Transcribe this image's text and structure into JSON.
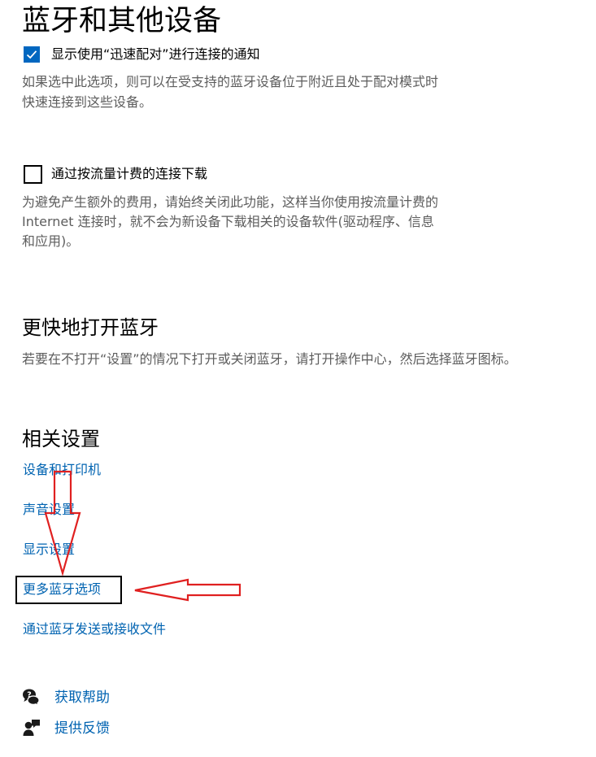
{
  "page": {
    "title": "蓝牙和其他设备"
  },
  "swift_pair": {
    "checked": true,
    "label": "显示使用“迅速配对”进行连接的通知",
    "description_lines": [
      "如果选中此选项，则可以在受支持的蓝牙设备位于附近且处于配对模式时",
      "快速连接到这些设备。"
    ]
  },
  "metered": {
    "checked": false,
    "label": "通过按流量计费的连接下载",
    "description_lines": [
      "为避免产生额外的费用，请始终关闭此功能，这样当你使用按流量计费的",
      "Internet 连接时，就不会为新设备下载相关的设备软件(驱动程序、信息",
      "和应用)。"
    ]
  },
  "quick_open": {
    "title": "更快地打开蓝牙",
    "description": "若要在不打开“设置”的情况下打开或关闭蓝牙，请打开操作中心，然后选择蓝牙图标。"
  },
  "related": {
    "title": "相关设置",
    "links": {
      "devices_printers": "设备和打印机",
      "sound": "声音设置",
      "display": "显示设置",
      "more_bluetooth": "更多蓝牙选项",
      "send_receive": "通过蓝牙发送或接收文件"
    }
  },
  "footer": {
    "help": "获取帮助",
    "feedback": "提供反馈"
  },
  "colors": {
    "accent": "#0067c0",
    "link": "#0063b1",
    "annotation": "#e02020"
  },
  "icons": {
    "checkbox_check": "check-icon",
    "help": "help-chat-icon",
    "feedback": "feedback-person-icon",
    "annotation_down": "down-arrow-annotation",
    "annotation_left": "left-arrow-annotation"
  }
}
